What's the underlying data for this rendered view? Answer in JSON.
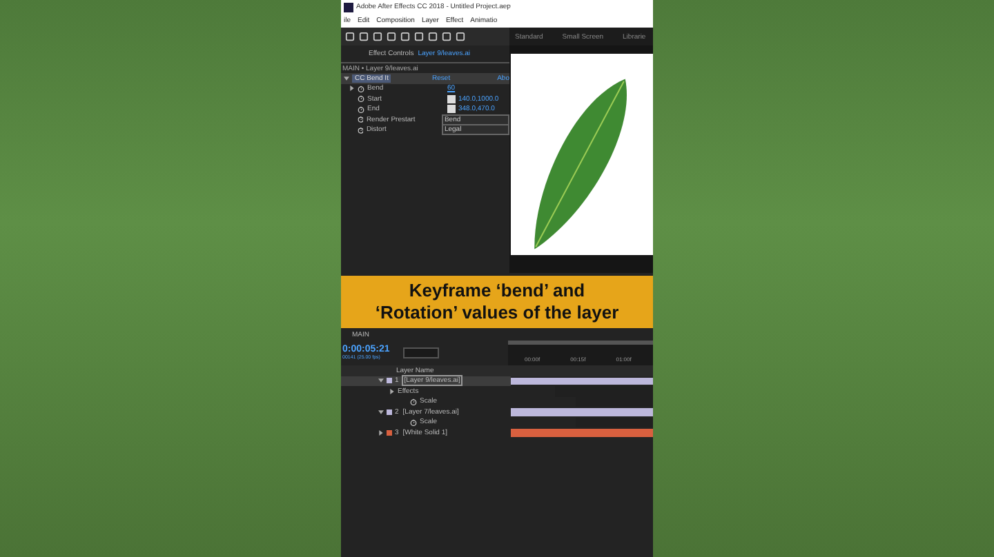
{
  "window": {
    "title": "Adobe After Effects CC 2018 - Untitled Project.aep"
  },
  "menu": [
    "ile",
    "Edit",
    "Composition",
    "Layer",
    "Effect",
    "Animatio"
  ],
  "workspaces": [
    "Standard",
    "Small Screen",
    "Librarie"
  ],
  "effect_panel": {
    "tab": "Effect Controls",
    "layer": "Layer 9/leaves.ai",
    "breadcrumb": "MAIN • Layer 9/leaves.ai",
    "effect": {
      "name": "CC Bend It",
      "reset": "Reset",
      "about": "Abo",
      "expanded": true
    },
    "properties": [
      {
        "name": "Bend",
        "kind": "number",
        "value": "60",
        "expandable": true
      },
      {
        "name": "Start",
        "kind": "point",
        "value": "140.0,1000.0",
        "expandable": false
      },
      {
        "name": "End",
        "kind": "point",
        "value": "348.0,470.0",
        "expandable": false
      },
      {
        "name": "Render Prestart",
        "kind": "dropdown",
        "value": "Bend",
        "expandable": false
      },
      {
        "name": "Distort",
        "kind": "dropdown",
        "value": "Legal",
        "expandable": false
      }
    ]
  },
  "caption": [
    "Keyframe ‘bend’ and",
    "‘Rotation’ values of the layer"
  ],
  "timeline": {
    "tab": "MAIN",
    "timecode": "0:00:05:21",
    "frames": "00141 (25.00 fps)",
    "column": "Layer Name",
    "ruler": [
      "00:00f",
      "00:15f",
      "01:00f"
    ],
    "layers": [
      {
        "number": "1",
        "name": "[Layer 9/leaves.ai]",
        "selected": true,
        "expanded": true,
        "color": "#bdb8dc",
        "children": [
          {
            "name": "Effects",
            "kind": "group"
          },
          {
            "name": "Scale",
            "kind": "property"
          }
        ]
      },
      {
        "number": "2",
        "name": "[Layer 7/leaves.ai]",
        "selected": false,
        "expanded": true,
        "color": "#bdb8dc",
        "children": [
          {
            "name": "Scale",
            "kind": "property"
          }
        ]
      },
      {
        "number": "3",
        "name": "[White Solid 1]",
        "selected": false,
        "expanded": false,
        "color": "#d9603f"
      }
    ]
  }
}
